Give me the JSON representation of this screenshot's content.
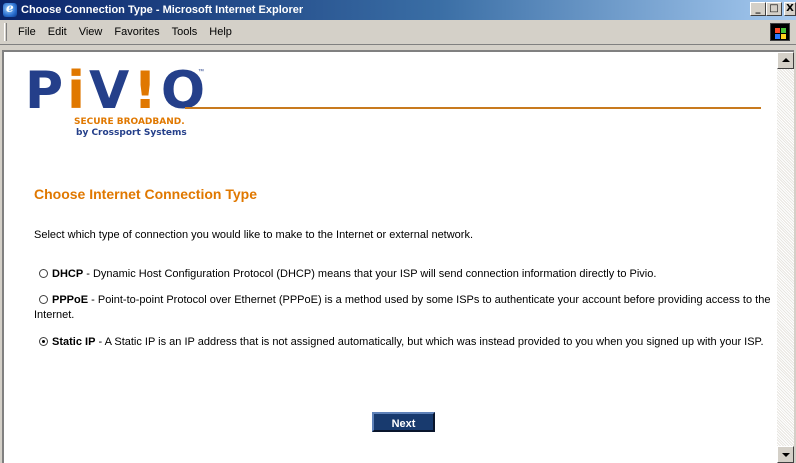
{
  "window": {
    "title": "Choose Connection Type - Microsoft Internet Explorer",
    "buttons": {
      "minimize": "_",
      "maximize": "□",
      "close": "X"
    }
  },
  "menu": {
    "items": [
      "File",
      "Edit",
      "View",
      "Favorites",
      "Tools",
      "Help"
    ]
  },
  "logo": {
    "word_part1": "P",
    "word_accent1": "i",
    "word_part2": "V",
    "word_accent2": "!",
    "word_part3": "O",
    "trademark": "™",
    "tagline": "SECURE BROADBAND.",
    "byline": "by Crossport Systems",
    "colors": {
      "blue": "#243f8a",
      "orange": "#e07800"
    }
  },
  "page": {
    "heading": "Choose Internet Connection Type",
    "intro": "Select which type of connection you would like to make to the Internet or external network.",
    "options": [
      {
        "name": "DHCP",
        "description": " - Dynamic Host Configuration Protocol (DHCP) means that your ISP will send connection information directly to Pivio.",
        "selected": false
      },
      {
        "name": "PPPoE",
        "description": " - Point-to-point Protocol over Ethernet (PPPoE) is a method used by some ISPs to authenticate your account before providing access to the Internet.",
        "selected": false
      },
      {
        "name": "Static IP",
        "description": " - A Static IP is an IP address that is not assigned automatically, but which was instead provided to you when you signed up with your ISP.",
        "selected": true
      }
    ],
    "next_label": "Next"
  }
}
